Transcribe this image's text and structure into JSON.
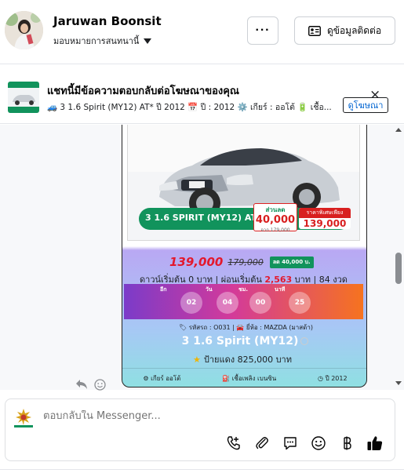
{
  "header": {
    "name": "Jaruwan Boonsit",
    "assign_label": "มอบหมายการสนทนานี้",
    "more_label": "···",
    "contact_label": "ดูข้อมูลติดต่อ"
  },
  "ad_banner": {
    "title": "แชทนี้มีข้อความตอบกลับต่อโฆษณาของคุณ",
    "subtitle": "🚙 3 1.6 Spirit (MY12) AT* ปี 2012 📅 ปี : 2012 ⚙️ เกียร์ : ออโต้ 🔋 เชื้อ...",
    "view_ad_label": "ดูโฆษณา",
    "close_icon": "×"
  },
  "ad_card": {
    "model_pill": "3 1.6 SPIRIT (MY12) AT",
    "discount_label": "ส่วนลด",
    "discount_value": "40,000",
    "discount_sub": "จาก 179,000",
    "special_label": "ราคาพิเศษเพียง",
    "special_value": "139,000",
    "price_main": "139,000",
    "price_old": "179,000",
    "price_discount_badge": "ลด 40,000 บ.",
    "terms_prefix": "ดาวน์เริ่มต้น 0 บาท | ผ่อนเริ่มต้น ",
    "terms_monthly": "2,563",
    "terms_suffix": " บาท | 84 งวด",
    "countdown": [
      {
        "label": "อีก",
        "value": "02"
      },
      {
        "label": "วัน",
        "value": "04"
      },
      {
        "label": "ชม.",
        "value": "00"
      },
      {
        "label": "นาที",
        "value": "25"
      }
    ],
    "specs_line": "🏷 รหัสรถ : O031 | 🚘 ยี่ห้อ : MAZDA (มาสด้า)",
    "model_name": "3 1.6 Spirit (MY12)",
    "plate_line": "ป้ายแดง 825,000 บาท",
    "footer_specs": [
      "⚙ เกียร์ ออโต้",
      "⛽ เชื้อเพลิง เบนซิน",
      "◷ ปี 2012"
    ]
  },
  "composer": {
    "placeholder": "ตอบกลับใน Messenger..."
  },
  "icons": {
    "contact_card": "contact-card-icon",
    "close": "close-icon",
    "share": "share-icon",
    "smile": "emoji-icon",
    "phone": "phone-add-icon",
    "attach": "paperclip-icon",
    "chat": "chat-bubble-icon",
    "emoji": "emoji-icon",
    "baht": "baht-icon",
    "like": "thumbs-up-icon"
  }
}
